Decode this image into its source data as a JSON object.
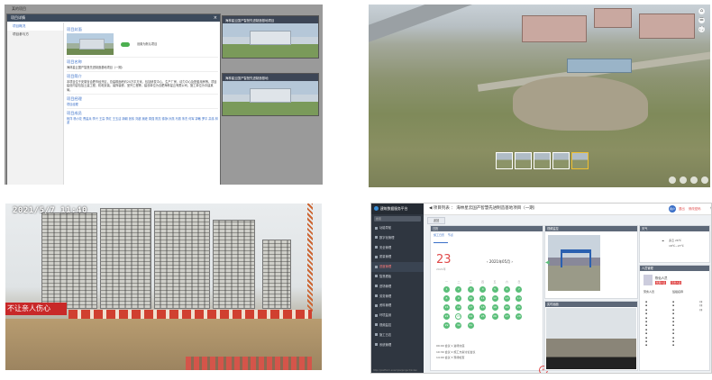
{
  "panel1": {
    "app_title": "某的项目",
    "dialog_title": "项目详情",
    "nav": [
      "项目概况",
      "项目参与方"
    ],
    "sections": {
      "cover_label": "项目封面",
      "toggle_label": "设置为默认项目",
      "name_label": "项目名称",
      "name_value": "海林星云国产智慧先进制造基地项目（一期）",
      "intro_label": "项目简介",
      "intro_text": "本项目位于安徽省合肥市经开区，总建筑面积约20万平方米，包括研发中心、生产厂房、动力中心及配套用房等。项目建设内容包括土建工程、机电安装、装饰装修、室外工程等，建设单位为合肥海林星云有限公司，施工单位为中建某局。",
      "manager_label": "项目经理",
      "manager_value": "项目经理",
      "members_label": "项目成员"
    },
    "members": [
      "杨洋",
      "杨小花",
      "曹建兵",
      "李兴",
      "王高",
      "李红",
      "王玉洁",
      "胡朝",
      "张伟",
      "刘超",
      "吴峰",
      "周强",
      "陈亮",
      "徐静",
      "孙燕",
      "马丽",
      "朱杰",
      "何军",
      "郭敏",
      "罗平",
      "高伟",
      "林波"
    ],
    "cards": [
      {
        "title": "海林星云国产智慧先进制造基地项目"
      },
      {
        "title": "海林星云国产智慧先进制造基地"
      }
    ]
  },
  "panel2": {
    "controls_right": [
      "⌂",
      "☰",
      "⛶"
    ],
    "thumbs": 5,
    "selected_thumb": 4
  },
  "panel3": {
    "timestamp": "2021/5/7 11:40",
    "banner": "不让亲人伤心"
  },
  "panel4": {
    "brand": "建筑数据服务平台",
    "search_placeholder": "搜索",
    "menu": [
      "功能导航",
      "数字化管理",
      "安全管理",
      "质量管理",
      "进度管理",
      "智慧看板",
      "进场管理",
      "劳务管理",
      "资料管理",
      "环境监测",
      "视频监控",
      "施工日志",
      "系统管理"
    ],
    "active_menu": 4,
    "breadcrumb_prefix": "项目列表",
    "breadcrumb_project": "海林星云国产智慧先进制造基地项目（一期）",
    "user_initials": "用户",
    "top_links": [
      "退出",
      "修改密码"
    ],
    "top_icons": [
      "⏱",
      "🔔",
      "⬇",
      "⏻"
    ],
    "back_label": "返回",
    "calendar": {
      "header": "日历",
      "tabs": [
        "施工日历",
        "节点"
      ],
      "day_big": "23",
      "day_sub": "2021年",
      "month_label": "2021年05月",
      "dow": [
        "一",
        "二",
        "三",
        "四",
        "五",
        "六",
        "日"
      ],
      "days": [
        "1",
        "2",
        "3",
        "4",
        "5",
        "6",
        "7",
        "8",
        "9",
        "10",
        "11",
        "12",
        "13",
        "14",
        "15",
        "16",
        "17",
        "18",
        "19",
        "20",
        "21",
        "22",
        "23",
        "24",
        "25",
        "26",
        "27",
        "28",
        "29",
        "30",
        "31",
        "",
        "",
        "",
        ""
      ],
      "selected_day": "23",
      "agenda": [
        "09:00  会议 1  进场交底",
        "10:30  会议 2  施工方案讨论会议",
        "14:00  会议 3  现场检查"
      ]
    },
    "camera_header": "视频监控",
    "camera2_header": "实时画面",
    "weather": {
      "header": "天气",
      "temp": "多云 26℃",
      "range": "18℃~27℃"
    },
    "person": {
      "header": "人员管理",
      "name": "陈仙人员",
      "badges": [
        "管理人员",
        "劳务人员"
      ],
      "tab": "劳务人员",
      "col_header": "班组名称"
    },
    "url": "http://platform.example/project/index"
  }
}
